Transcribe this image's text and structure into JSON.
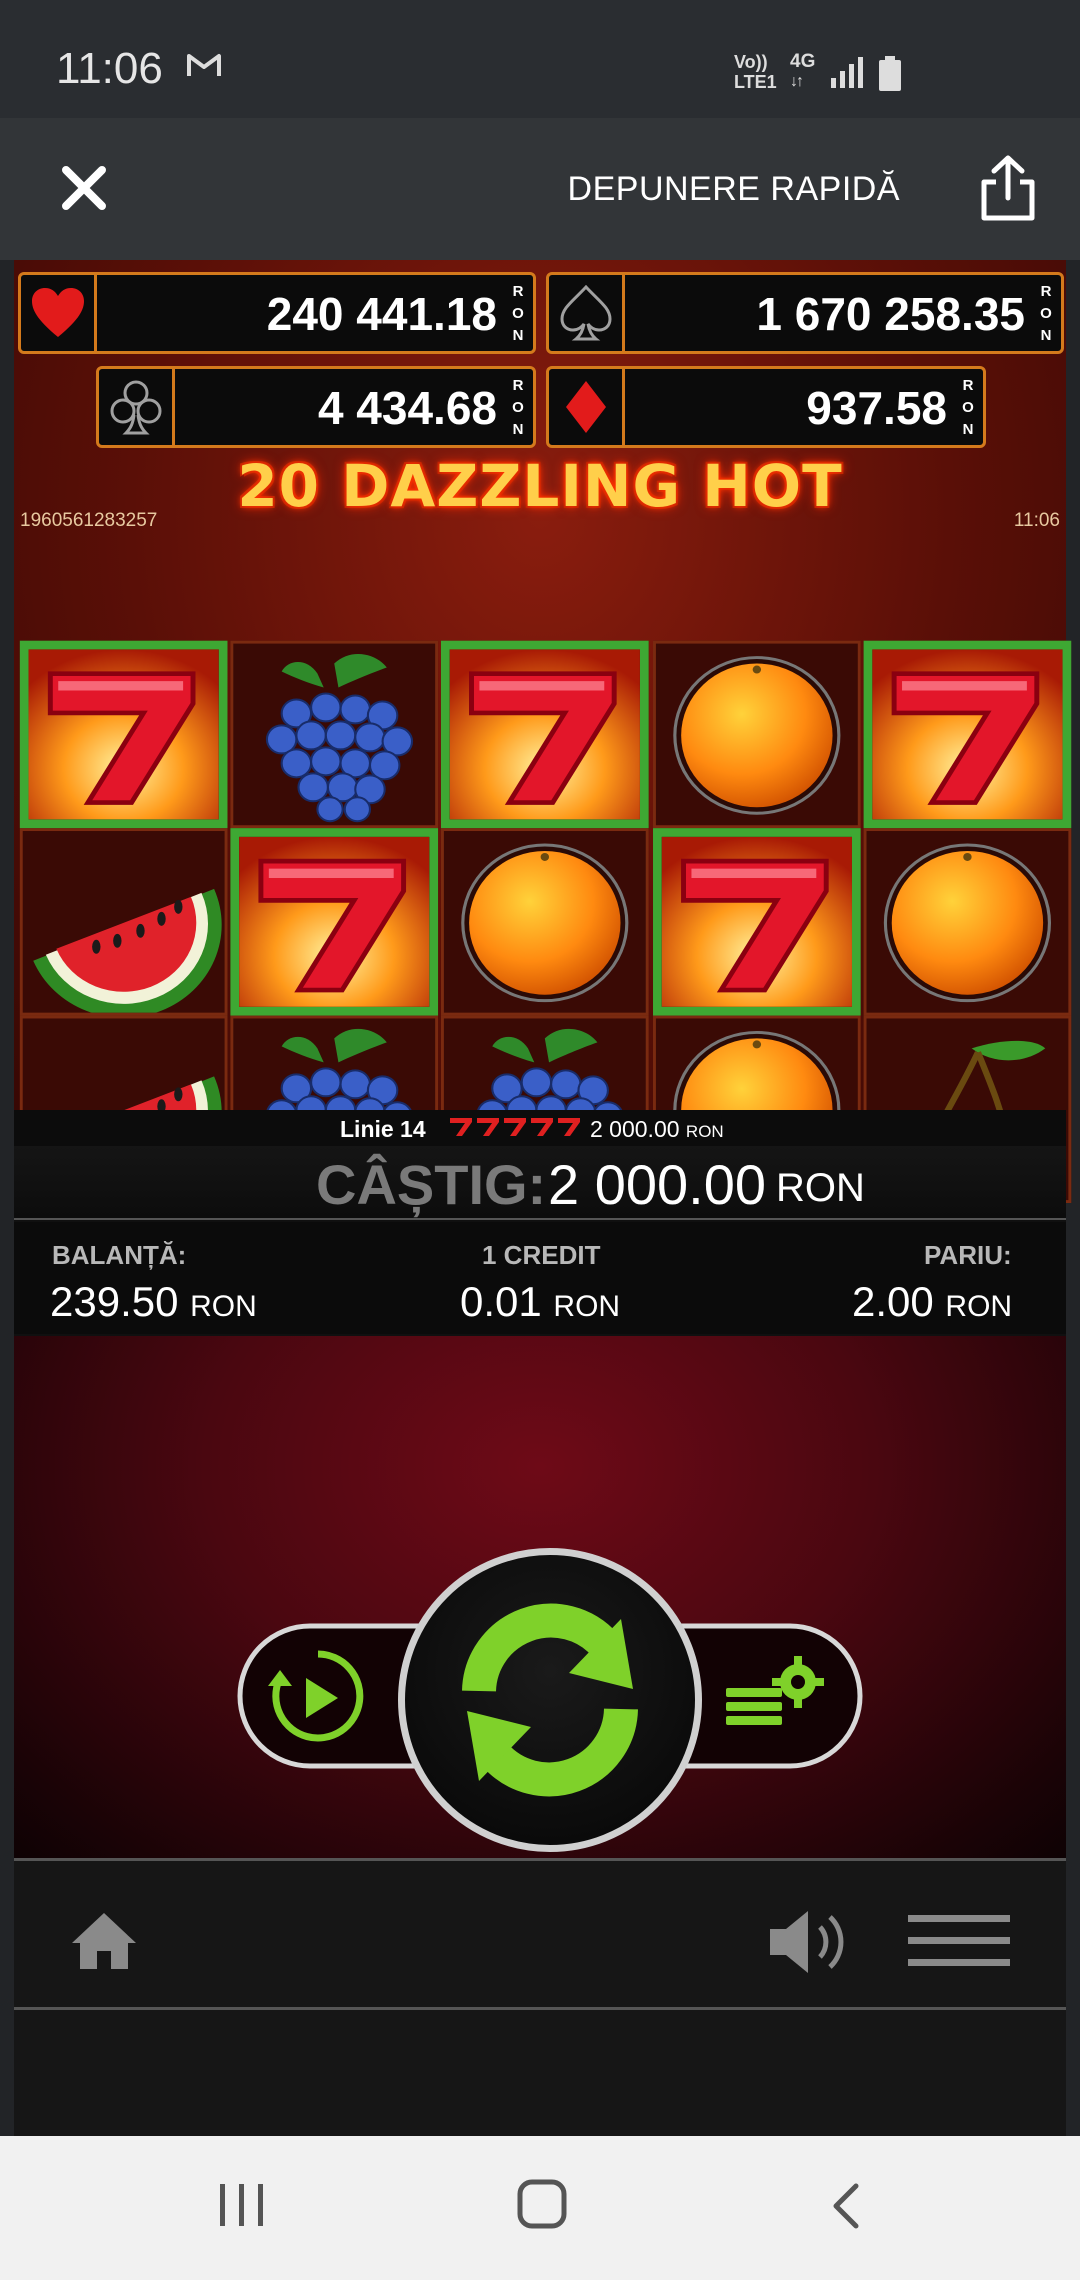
{
  "status_bar": {
    "time": "11:06",
    "net_volte": "Vo))",
    "net_lte": "LTE1",
    "net_type": "4G",
    "icons": [
      "gmail-icon",
      "volte-icon",
      "signal-icon",
      "battery-icon"
    ]
  },
  "top_bar": {
    "close_icon": "close-icon",
    "deposit_label": "DEPUNERE RAPIDĂ",
    "share_icon": "share-icon"
  },
  "jackpots": [
    {
      "suit": "heart",
      "amount": "240 441.18",
      "currency": "RON",
      "color": "#e21b1b"
    },
    {
      "suit": "spade",
      "amount": "1 670 258.35",
      "currency": "RON",
      "color": "#9a9a9a"
    },
    {
      "suit": "club",
      "amount": "4 434.68",
      "currency": "RON",
      "color": "#9a9a9a"
    },
    {
      "suit": "diamond",
      "amount": "937.58",
      "currency": "RON",
      "color": "#e21b1b"
    }
  ],
  "game": {
    "title": "20 DAZZLING HOT",
    "game_id": "1960561283257",
    "clock": "11:06",
    "reels": [
      [
        "seven",
        "watermelon",
        "watermelon"
      ],
      [
        "grapes",
        "seven",
        "grapes"
      ],
      [
        "seven",
        "orange",
        "grapes"
      ],
      [
        "orange",
        "seven",
        "orange"
      ],
      [
        "seven",
        "orange",
        "cherries"
      ]
    ],
    "winning_line": "Linie 14",
    "winning_line_value": "2 000.00",
    "winning_line_currency": "RON",
    "win_label": "CÂȘTIG:",
    "win_amount": "2 000.00",
    "win_currency": "RON"
  },
  "stats": {
    "balance_label": "BALANȚĂ:",
    "balance_value": "239.50",
    "credit_label": "1 CREDIT",
    "credit_value": "0.01",
    "bet_label": "PARIU:",
    "bet_value": "2.00",
    "currency": "RON"
  },
  "controls": {
    "autoplay_icon": "autoplay-icon",
    "spin_icon": "spin-icon",
    "bet_settings_icon": "bet-settings-icon",
    "accent": "#7fd12a"
  },
  "bottom_bar": {
    "home_icon": "home-icon",
    "sound_icon": "sound-icon",
    "menu_icon": "menu-icon"
  },
  "nav_bar": {
    "recents_icon": "recents-icon",
    "home_icon": "home-icon",
    "back_icon": "back-icon"
  }
}
